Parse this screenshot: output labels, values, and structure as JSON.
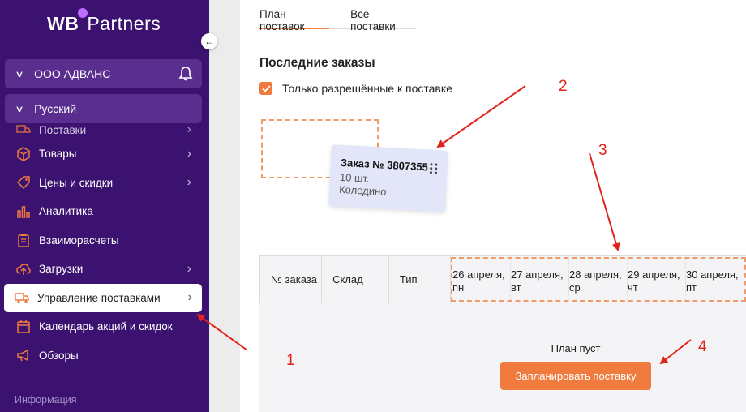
{
  "brand": {
    "wb": "WB",
    "partners": "Partners"
  },
  "org": {
    "name": "ООО АДВАНС"
  },
  "language": {
    "name": "Русский"
  },
  "menu": {
    "items": [
      {
        "label": "Поставки",
        "icon": "truck-icon",
        "arrow": true
      },
      {
        "label": "Товары",
        "icon": "box-icon",
        "arrow": true
      },
      {
        "label": "Цены и скидки",
        "icon": "tag-icon",
        "arrow": true
      },
      {
        "label": "Аналитика",
        "icon": "chart-icon",
        "arrow": false
      },
      {
        "label": "Взаиморасчеты",
        "icon": "clipboard-icon",
        "arrow": false
      },
      {
        "label": "Загрузки",
        "icon": "cloud-upload-icon",
        "arrow": true
      },
      {
        "label": "Управление поставками",
        "icon": "truck-icon",
        "arrow": true
      },
      {
        "label": "Календарь акций и скидок",
        "icon": "calendar-icon",
        "arrow": false
      },
      {
        "label": "Обзоры",
        "icon": "megaphone-icon",
        "arrow": false
      }
    ],
    "section_info": "Информация"
  },
  "tabs": [
    {
      "label": "План поставок"
    },
    {
      "label": "Все поставки"
    }
  ],
  "recent_orders": {
    "title": "Последние заказы",
    "filter_label": "Только разрешённые к поставке"
  },
  "order_card": {
    "title": "Заказ № 3807355",
    "qty": "10 шт.",
    "warehouse": "Коледино"
  },
  "table": {
    "columns": [
      "№ заказа",
      "Склад",
      "Тип"
    ],
    "days": [
      {
        "date": "26 апреля,",
        "weekday": "пн"
      },
      {
        "date": "27 апреля,",
        "weekday": "вт"
      },
      {
        "date": "28 апреля,",
        "weekday": "ср"
      },
      {
        "date": "29 апреля,",
        "weekday": "чт"
      },
      {
        "date": "30 апреля,",
        "weekday": "пт"
      }
    ],
    "empty_text": "План пуст",
    "plan_button": "Запланировать поставку"
  },
  "annotations": {
    "n1": "1",
    "n2": "2",
    "n3": "3",
    "n4": "4"
  },
  "colors": {
    "sidebar": "#3b1270",
    "accent": "#f07b3f",
    "arrow": "#e0231b"
  }
}
